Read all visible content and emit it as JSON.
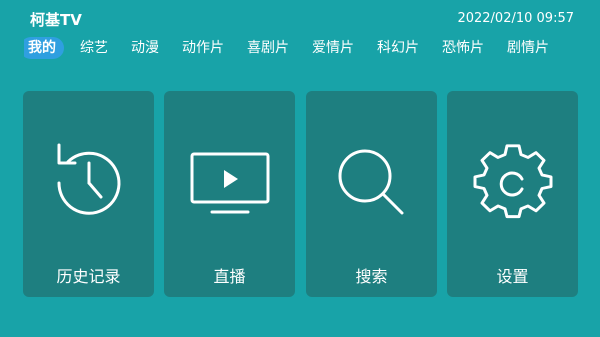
{
  "app": {
    "title": "柯基TV",
    "datetime": "2022/02/10 09:57"
  },
  "tabs": [
    {
      "label": "我的",
      "active": true
    },
    {
      "label": "综艺"
    },
    {
      "label": "动漫"
    },
    {
      "label": "动作片"
    },
    {
      "label": "喜剧片"
    },
    {
      "label": "爱情片"
    },
    {
      "label": "科幻片"
    },
    {
      "label": "恐怖片"
    },
    {
      "label": "剧情片"
    }
  ],
  "cards": [
    {
      "label": "历史记录",
      "icon": "history-clock-icon"
    },
    {
      "label": "直播",
      "icon": "tv-play-icon"
    },
    {
      "label": "搜索",
      "icon": "search-icon"
    },
    {
      "label": "设置",
      "icon": "gear-icon"
    }
  ],
  "colors": {
    "background": "#18a3a8",
    "card": "#1e7f80",
    "active_tab": "#2f9fe0",
    "text": "#ffffff"
  }
}
